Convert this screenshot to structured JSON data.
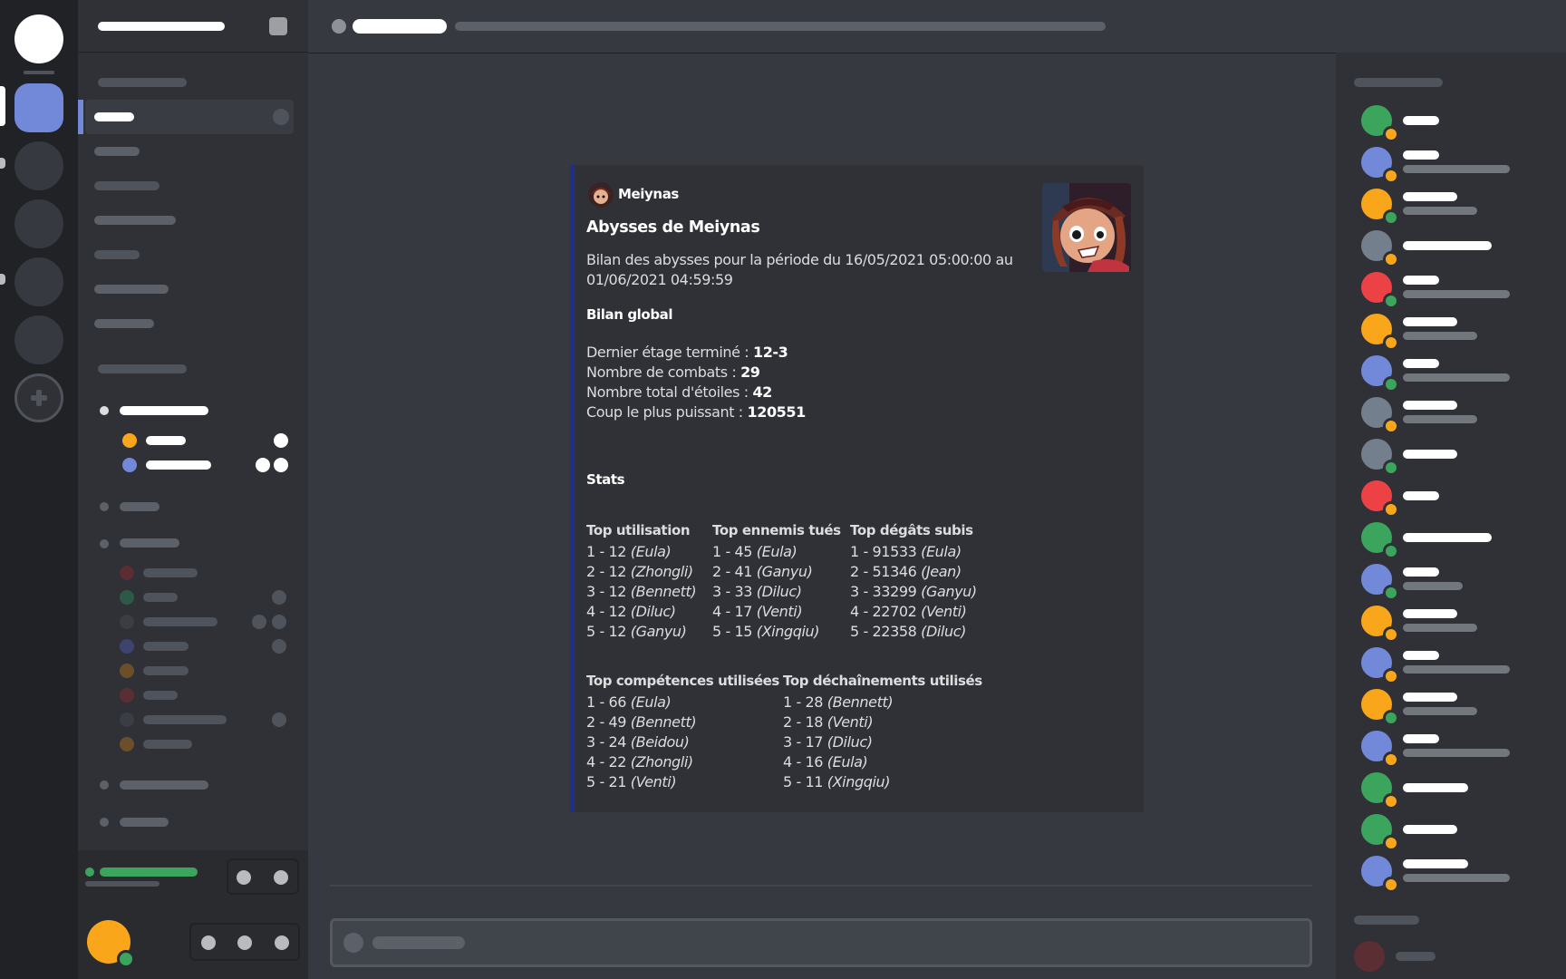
{
  "embed": {
    "author": "Meiynas",
    "title": "Abysses de Meiynas",
    "description_line1": "Bilan des abysses pour la période du 16/05/2021 05:00:00 au",
    "description_line2": "01/06/2021 04:59:59",
    "global_heading": "Bilan global",
    "global": [
      {
        "label": "Dernier étage terminé : ",
        "value": "12-3"
      },
      {
        "label": "Nombre de combats : ",
        "value": "29"
      },
      {
        "label": "Nombre total d'étoiles : ",
        "value": "42"
      },
      {
        "label": "Coup le plus puissant : ",
        "value": "120551"
      }
    ],
    "stats_heading": "Stats",
    "columns": [
      {
        "title": "Top utilisation",
        "items": [
          {
            "prefix": "1 - 12 ",
            "name": "(Eula)"
          },
          {
            "prefix": "2 - 12 ",
            "name": "(Zhongli)"
          },
          {
            "prefix": "3 - 12 ",
            "name": "(Bennett)"
          },
          {
            "prefix": "4 - 12 ",
            "name": "(Diluc)"
          },
          {
            "prefix": "5 - 12 ",
            "name": "(Ganyu)"
          }
        ]
      },
      {
        "title": "Top ennemis tués",
        "items": [
          {
            "prefix": "1 - 45 ",
            "name": "(Eula)"
          },
          {
            "prefix": "2 - 41 ",
            "name": "(Ganyu)"
          },
          {
            "prefix": "3 - 33 ",
            "name": "(Diluc)"
          },
          {
            "prefix": "4 - 17 ",
            "name": "(Venti)"
          },
          {
            "prefix": "5 - 15 ",
            "name": "(Xingqiu)"
          }
        ]
      },
      {
        "title": "Top dégâts subis",
        "items": [
          {
            "prefix": "1 - 91533 ",
            "name": "(Eula)"
          },
          {
            "prefix": "2 - 51346 ",
            "name": "(Jean)"
          },
          {
            "prefix": "3 - 33299 ",
            "name": "(Ganyu)"
          },
          {
            "prefix": "4 - 22702 ",
            "name": "(Venti)"
          },
          {
            "prefix": "5 - 22358 ",
            "name": "(Diluc)"
          }
        ]
      },
      {
        "title": "Top compétences utilisées",
        "items": [
          {
            "prefix": "1 - 66 ",
            "name": "(Eula)"
          },
          {
            "prefix": "2 - 49 ",
            "name": "(Bennett)"
          },
          {
            "prefix": "3 - 24 ",
            "name": "(Beidou)"
          },
          {
            "prefix": "4 - 22 ",
            "name": "(Zhongli)"
          },
          {
            "prefix": "5 - 21 ",
            "name": "(Venti)"
          }
        ]
      },
      {
        "title": "Top déchaînements utilisés",
        "items": [
          {
            "prefix": "1 - 28 ",
            "name": "(Bennett)"
          },
          {
            "prefix": "2 - 18 ",
            "name": "(Venti)"
          },
          {
            "prefix": "3 - 17 ",
            "name": "(Diluc)"
          },
          {
            "prefix": "4 - 16 ",
            "name": "(Eula)"
          },
          {
            "prefix": "5 - 11 ",
            "name": "(Xingqiu)"
          }
        ]
      }
    ]
  },
  "colors": {
    "accent": "#7289da",
    "online": "#3ba55d",
    "idle": "#faa61a",
    "dnd": "#ed4245",
    "embed_border": "#1f2d8f"
  },
  "icons": [
    "add-server-icon",
    "server-settings-icon",
    "channel-hash-icon",
    "avatar-icon",
    "embed-thumbnail"
  ]
}
